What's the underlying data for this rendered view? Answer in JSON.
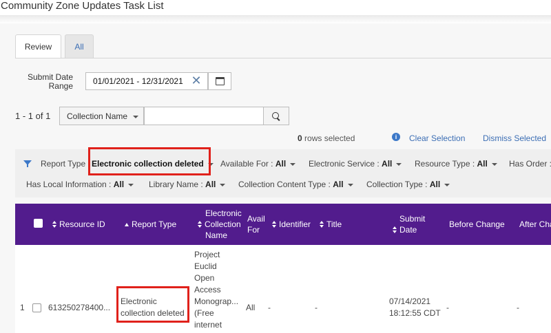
{
  "page": {
    "title": "Community Zone Updates Task List"
  },
  "tabs": [
    {
      "label": "Review",
      "active": true
    },
    {
      "label": "All",
      "active": false
    }
  ],
  "date_filter": {
    "label": "Submit Date Range",
    "value": "01/01/2021 - 12/31/2021",
    "clear_icon": "close-icon",
    "calendar_icon": "calendar-icon"
  },
  "search": {
    "count": "1 - 1 of 1",
    "field_select": "Collection Name",
    "value": "",
    "button_icon": "search-icon"
  },
  "selection": {
    "rows_count": "0",
    "rows_label": "rows selected",
    "clear_label": "Clear Selection",
    "dismiss_label": "Dismiss Selected"
  },
  "filters": {
    "report_type": {
      "label": "Report Type :",
      "value": "Electronic collection deleted"
    },
    "available_for": {
      "label": "Available For :",
      "value": "All"
    },
    "electronic_service": {
      "label": "Electronic Service :",
      "value": "All"
    },
    "resource_type": {
      "label": "Resource Type :",
      "value": "All"
    },
    "has_order": {
      "label": "Has Order :"
    },
    "has_local_information": {
      "label": "Has Local Information :",
      "value": "All"
    },
    "library_name": {
      "label": "Library Name :",
      "value": "All"
    },
    "collection_content_type": {
      "label": "Collection Content Type :",
      "value": "All"
    },
    "collection_type": {
      "label": "Collection Type :",
      "value": "All"
    }
  },
  "table": {
    "columns": {
      "resource_id": "Resource ID",
      "report_type": "Report Type",
      "electronic_collection_name": [
        "Electronic",
        "Collection",
        "Name"
      ],
      "avail_for": [
        "Avail",
        "For"
      ],
      "identifier": "Identifier",
      "title": "Title",
      "submit_date": [
        "Submit",
        "Date"
      ],
      "before_change": "Before Change",
      "after_change": "After Cha"
    },
    "rows": [
      {
        "index": "1",
        "resource_id": "613250278400...",
        "report_type": [
          "Electronic",
          "collection deleted"
        ],
        "collection_name": [
          "Project",
          "Euclid",
          "Open",
          "Access",
          "Monograp...",
          "(Free",
          "internet"
        ],
        "avail_for": "All",
        "identifier": "-",
        "title": "-",
        "submit_date": [
          "07/14/2021",
          "18:12:55 CDT"
        ],
        "before_change": "-",
        "after_change": "-"
      }
    ]
  },
  "colors": {
    "header_bg": "#521c8d",
    "link": "#3c6eb4",
    "highlight_box": "#e0211b"
  }
}
